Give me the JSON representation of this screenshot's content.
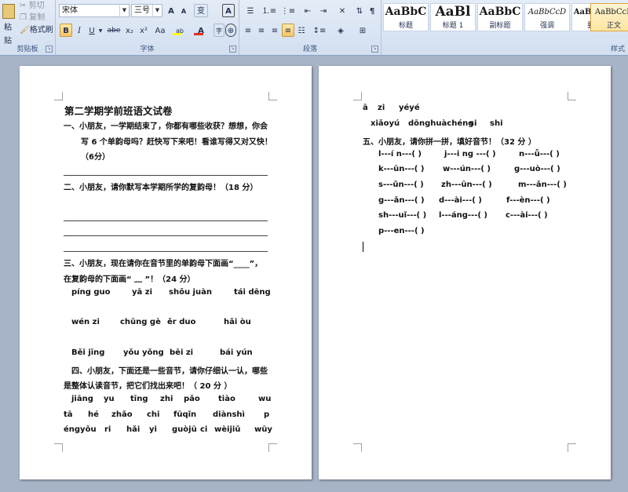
{
  "clipboard": {
    "paste": "粘贴",
    "cut": "剪切",
    "copy": "复制",
    "format_painter": "格式刷",
    "group_label": "剪贴板"
  },
  "font": {
    "family": "宋体",
    "size": "三号",
    "grow": "A",
    "shrink": "A",
    "phonetic": "变",
    "border_char": "A",
    "bold": "B",
    "italic": "I",
    "underline": "U",
    "strike": "abe",
    "subscript": "x₂",
    "superscript": "x²",
    "change_case": "Aa",
    "highlight": "ab",
    "font_color": "A",
    "enclose": "字",
    "group_label": "字体",
    "highlight_color": "#ffff00",
    "font_color_value": "#e03020"
  },
  "paragraph": {
    "group_label": "段落"
  },
  "styles": {
    "group_label": "样式",
    "items": [
      {
        "sample": "AaBbC",
        "name": "标题"
      },
      {
        "sample": "AaBl",
        "name": "标题 1"
      },
      {
        "sample": "AaBbC",
        "name": "副标题"
      },
      {
        "sample": "AaBbCcD",
        "name": "强调"
      },
      {
        "sample": "AaBbCcD",
        "name": "要点"
      },
      {
        "sample": "AaBbCcD",
        "name": "正文"
      }
    ]
  },
  "doc": {
    "page1": {
      "title": "第二学期学前班语文试卷",
      "q1_l1": "一、小朋友，一学期结束了，你都有哪些收获？想想，你会",
      "q1_l2": "写 6 个单韵母吗？赶快写下来吧！看谁写得又对又快！",
      "q1_l3": "（6分）",
      "q2": "二、小朋友，请你默写本学期所学的复韵母！（18 分）",
      "q3_l1": "三、小朋友，现在请你在音节里的单韵母下面画“____”，",
      "q3_l2": "在复韵母的下面画“ ﹏ ”！（24 分）",
      "q3_r1": [
        "píng  guo",
        "yā  zi",
        "shǒu juàn",
        "tái dēng"
      ],
      "q3_r2": [
        "wén zi",
        "chūng gè",
        "ěr duo",
        "hǎi òu"
      ],
      "q3_r3": [
        "Běi jīng",
        "yǒu yǒng",
        "bēi zi",
        "bái yún"
      ],
      "q4_l1": "四、小朋友，下面还是一些音节，请你仔细认一认，哪些",
      "q4_l2": "是整体认读音节，把它们找出来吧！（ 20 分 ）",
      "q4_r1": [
        "jiāng",
        "yu",
        "tīng",
        "zhi",
        "pǎo",
        "tiào",
        "wu"
      ],
      "q4_r2": [
        "tā",
        "hé",
        "zhǎo",
        "chi",
        "fūqǐn",
        "diànshì",
        "p"
      ],
      "q4_r3": [
        "éngyǒu",
        "ri",
        "hǎi",
        "yi",
        "guòjū",
        "ci",
        "wèijiǔ",
        "wūy"
      ]
    },
    "page2": {
      "l1": [
        "ā",
        "zi",
        "yéyé"
      ],
      "l2": [
        "xiǎoyú",
        "dōnghuàchéng",
        "si",
        "shi"
      ],
      "q5": "五、小朋友，请你拼一拼，填好音节！（32 分 ）",
      "r1": [
        "l---í n---(    )",
        "j---i ng ---(    )",
        "n---ǚ---(    )"
      ],
      "r2": [
        "k---ūn---(    )",
        "w---ún---(    )",
        "g---uò---(    )"
      ],
      "r3": [
        "s---ǔn---(    )",
        "zh---ūn---(    )",
        "m---ǎn---(    )"
      ],
      "r4": [
        "g---ǎn---(    )",
        "d---ài---(    )",
        "f---èn---(    )"
      ],
      "r5": [
        "sh---uǐ---(    )",
        "l---áng---(    )",
        "c---ài---(    )"
      ],
      "r6": [
        "p---en---(    )"
      ]
    }
  }
}
